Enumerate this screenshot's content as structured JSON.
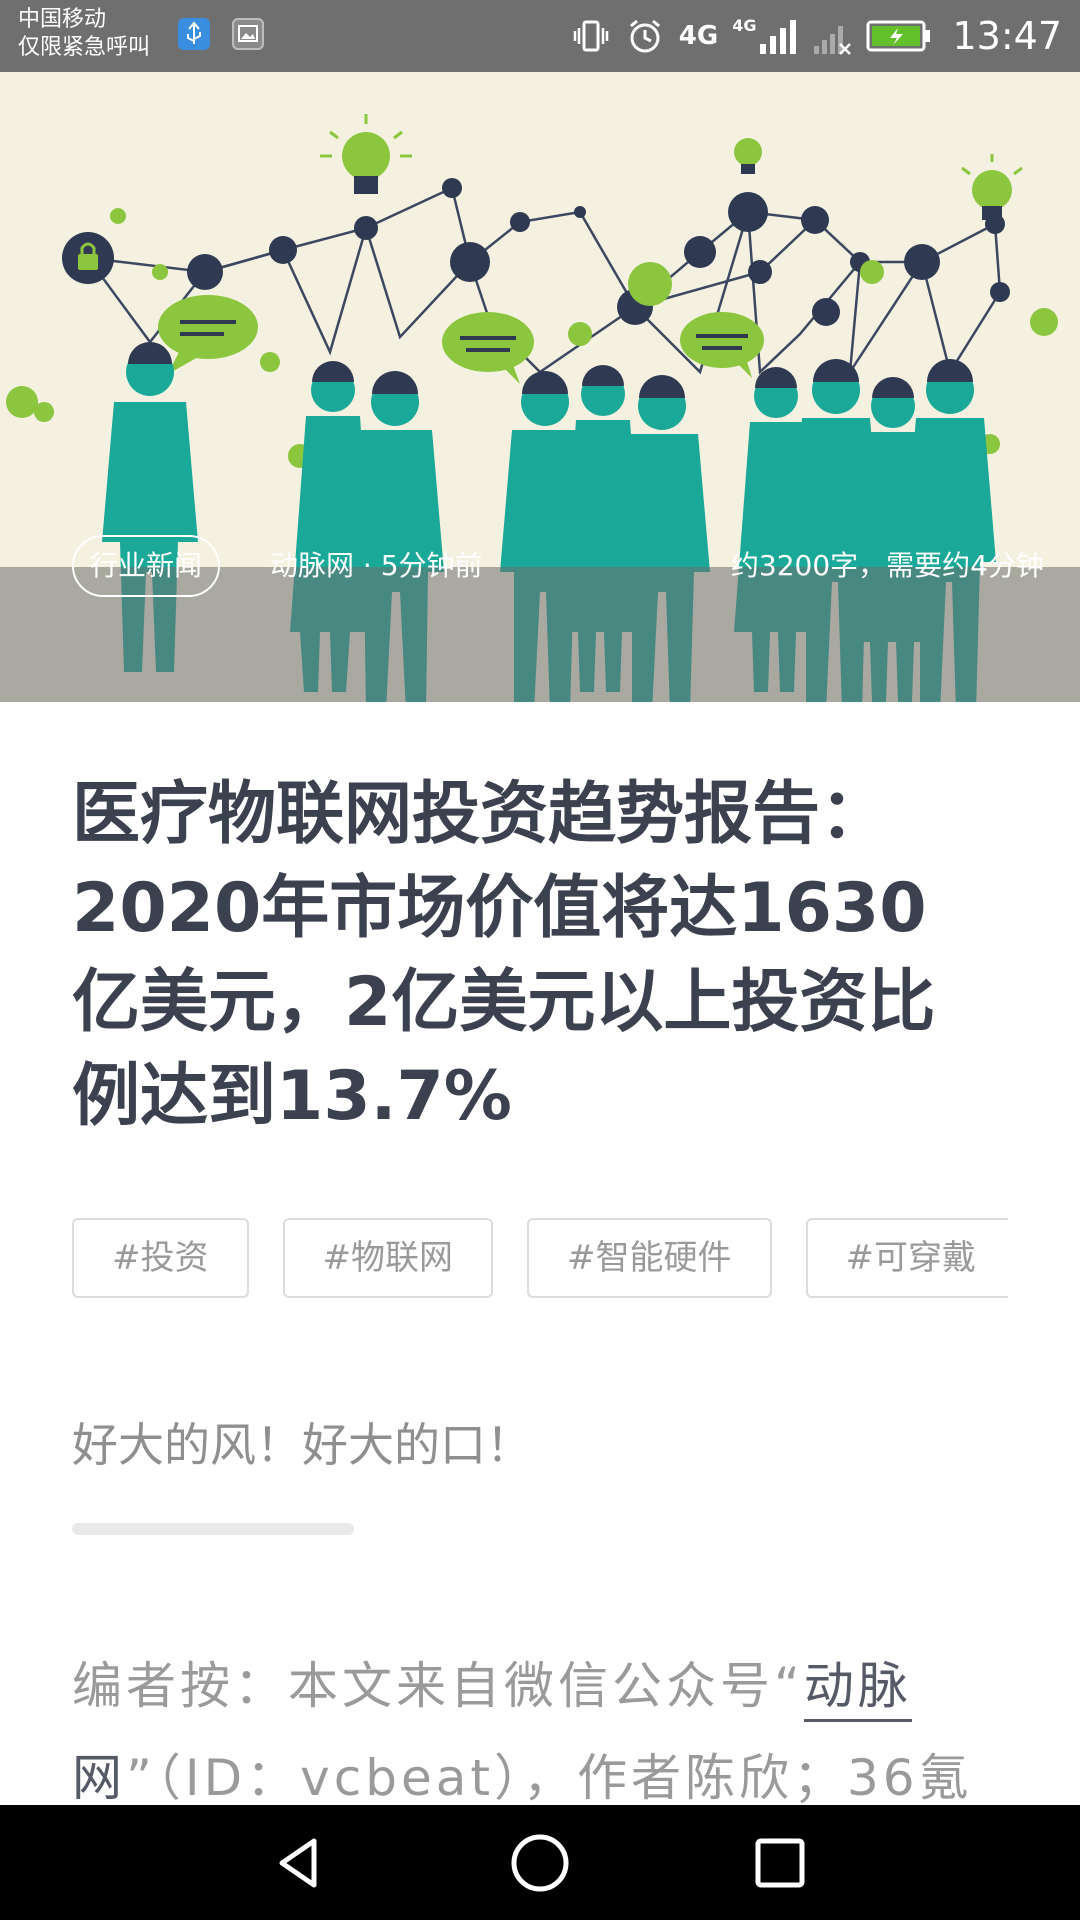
{
  "status_bar": {
    "carrier_line1": "中国移动",
    "carrier_line2": "仅限紧急呼叫",
    "network_1": "4G",
    "network_2": "4G",
    "time": "13:47",
    "icons": [
      "usb-icon",
      "image-icon",
      "vibrate-icon",
      "alarm-icon",
      "signal-icon",
      "no-signal-icon",
      "battery-charging-icon"
    ]
  },
  "hero": {
    "tag": "行业新闻",
    "meta": "动脉网 · 5分钟前",
    "read_info": "约3200字，需要约4分钟"
  },
  "article": {
    "title": "医疗物联网投资趋势报告：2020年市场价值将达1630亿美元，2亿美元以上投资比例达到13.7%",
    "tags": [
      "#投资",
      "#物联网",
      "#智能硬件",
      "#可穿戴"
    ],
    "subtitle": "好大的风！好大的口！",
    "editor_note_prefix": "编者按：本文来自微信公众号“",
    "editor_note_link": "动脉网",
    "editor_note_suffix": "”（ID：vcbeat），作者陈欣；36氪"
  },
  "colors": {
    "status_bar_bg": "#6f6f6f",
    "hero_bg": "#f4f1e0",
    "title_text": "#3c4150",
    "people_teal": "#1aa899",
    "accent_green": "#8cc63f",
    "nav_bg": "#000000"
  },
  "nav_bar": {
    "icons": [
      "back-icon",
      "home-icon",
      "recent-apps-icon"
    ]
  }
}
